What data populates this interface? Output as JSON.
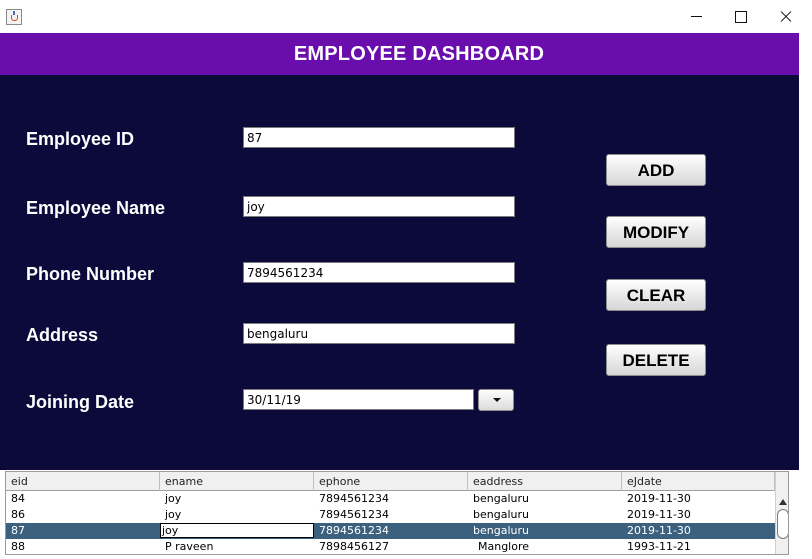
{
  "window": {
    "icons": {
      "app": "java-cup-icon",
      "minimize": "minimize-icon",
      "maximize": "maximize-icon",
      "close": "close-icon"
    }
  },
  "header": {
    "title": "EMPLOYEE DASHBOARD"
  },
  "form": {
    "employee_id": {
      "label": "Employee ID",
      "value": "87"
    },
    "employee_name": {
      "label": "Employee Name",
      "value": "joy"
    },
    "phone_number": {
      "label": "Phone Number",
      "value": "7894561234"
    },
    "address": {
      "label": "Address",
      "value": "bengaluru"
    },
    "joining_date": {
      "label": "Joining Date",
      "value": "30/11/19"
    }
  },
  "buttons": {
    "add": "ADD",
    "modify": "MODIFY",
    "clear": "CLEAR",
    "delete": "DELETE"
  },
  "table": {
    "columns": [
      "eid",
      "ename",
      "ephone",
      "eaddress",
      "eJdate"
    ],
    "rows": [
      [
        "84",
        "joy",
        "7894561234",
        "bengaluru",
        "2019-11-30"
      ],
      [
        "86",
        "joy",
        "7894561234",
        "bengaluru",
        "2019-11-30"
      ],
      [
        "87",
        "joy",
        "7894561234",
        "bengaluru",
        "2019-11-30"
      ],
      [
        "88",
        "P raveen",
        "7898456127",
        "Manglore",
        "1993-11-21"
      ]
    ],
    "selected_row_index": 2
  },
  "colors": {
    "header_bg": "#6a0dad",
    "panel_bg": "#0c0a3a",
    "selected_row_bg": "#3c617e",
    "label_text": "#ffffff"
  }
}
